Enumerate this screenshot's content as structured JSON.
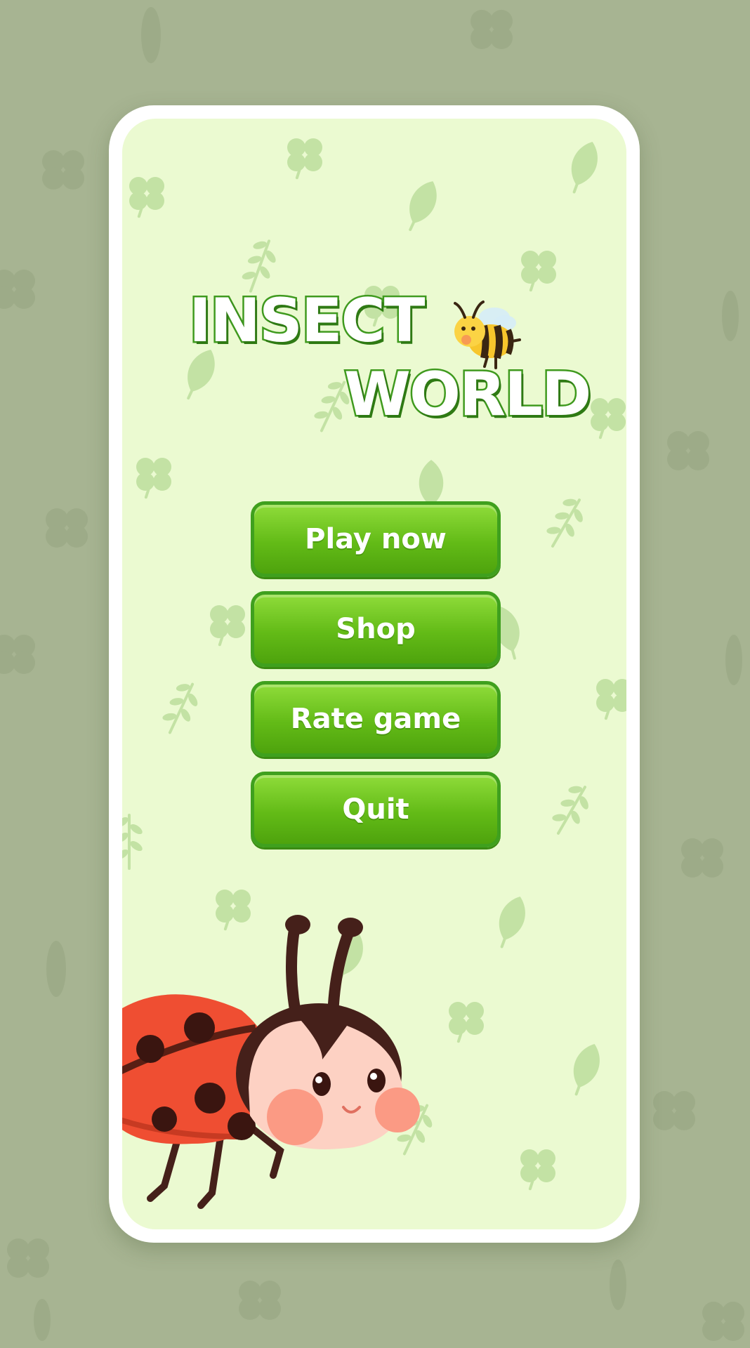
{
  "title": {
    "line1": "INSECT",
    "line2": "WORLD"
  },
  "menu": {
    "play_label": "Play now",
    "shop_label": "Shop",
    "rate_label": "Rate game",
    "quit_label": "Quit"
  },
  "colors": {
    "outer_background": "#a7b492",
    "screen_background": "#ebfad1",
    "button_green": "#63bb17",
    "button_border": "#3fa01e",
    "title_stroke": "#3f9a1e",
    "deco_leaf": "#c3e2a4"
  },
  "icons": {
    "title_mascot": "bee-icon",
    "hero_character": "ladybug-icon",
    "background_pattern": [
      "clover-icon",
      "leaf-icon",
      "fern-icon"
    ]
  }
}
